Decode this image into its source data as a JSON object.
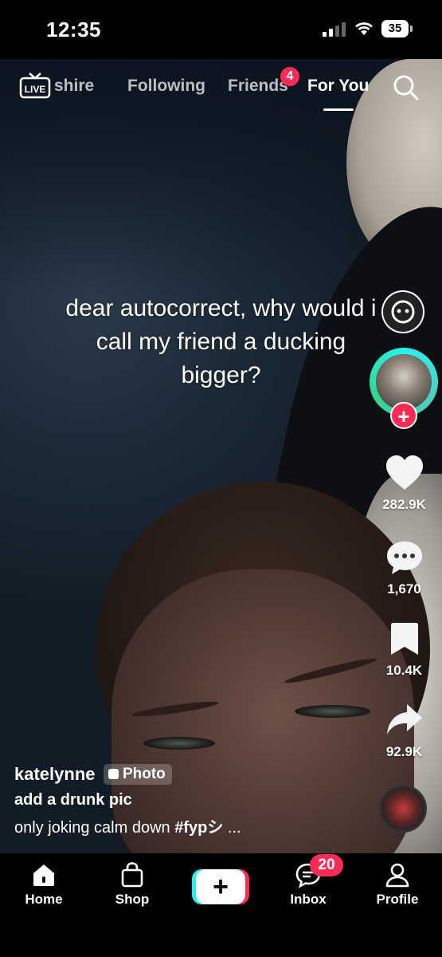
{
  "status_bar": {
    "time": "12:35",
    "battery": "35",
    "icons": [
      "cellular-signal-icon",
      "wifi-icon",
      "battery-icon"
    ]
  },
  "top_nav": {
    "live_label": "LIVE",
    "tabs": [
      {
        "label": "shire",
        "active": false
      },
      {
        "label": "Following",
        "active": false
      },
      {
        "label": "Friends",
        "active": false,
        "badge": "4"
      },
      {
        "label": "For You",
        "active": true
      }
    ],
    "search_icon": "search-icon"
  },
  "video": {
    "overlay_text": "dear autocorrect, why would i call my friend a ducking bigger?"
  },
  "rail": {
    "likes": "282.9K",
    "comments": "1,670",
    "saves": "10.4K",
    "shares": "92.9K"
  },
  "caption": {
    "username": "katelynne",
    "badge": "Photo",
    "title": "add a drunk pic",
    "desc_text": "only joking calm down ",
    "desc_tag": "#fypシ",
    "desc_more": " ..."
  },
  "bottom_nav": {
    "home": "Home",
    "shop": "Shop",
    "create": "+",
    "inbox": "Inbox",
    "inbox_badge": "20",
    "profile": "Profile"
  },
  "colors": {
    "accent_red": "#fe2c55",
    "accent_cyan": "#25f4ee",
    "background": "#000000"
  }
}
